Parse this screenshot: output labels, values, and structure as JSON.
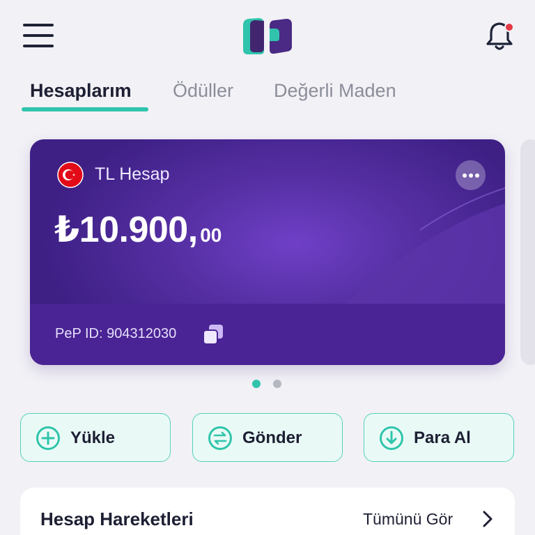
{
  "header": {
    "menu_icon": "hamburger-menu-icon",
    "logo_icon": "brand-logo-icon",
    "notification_icon": "bell-icon",
    "notification_badge_color": "#e53946"
  },
  "tabs": [
    {
      "label": "Hesaplarım",
      "active": true
    },
    {
      "label": "Ödüller",
      "active": false
    },
    {
      "label": "Değerli Maden",
      "active": false
    }
  ],
  "account_card": {
    "title": "TL Hesap",
    "flag_icon": "turkey-flag-icon",
    "balance_integer": "₺10.900",
    "balance_separator": ",",
    "balance_decimal": "00",
    "pep_id": "PeP ID: 904312030",
    "copy_icon": "copy-icon",
    "more_icon": "more-dots-icon"
  },
  "pager": {
    "total": 2,
    "active_index": 0
  },
  "actions": [
    {
      "label": "Yükle",
      "icon": "plus-circle-icon"
    },
    {
      "label": "Gönder",
      "icon": "transfer-circle-icon"
    },
    {
      "label": "Para Al",
      "icon": "download-circle-icon"
    }
  ],
  "transactions": {
    "title": "Hesap Hareketleri",
    "see_all": "Tümünü Gör"
  },
  "colors": {
    "accent": "#2fc4ab",
    "card_purple": "#5730a5",
    "text_dark": "#1d1f33",
    "text_muted": "#8b8d99"
  }
}
